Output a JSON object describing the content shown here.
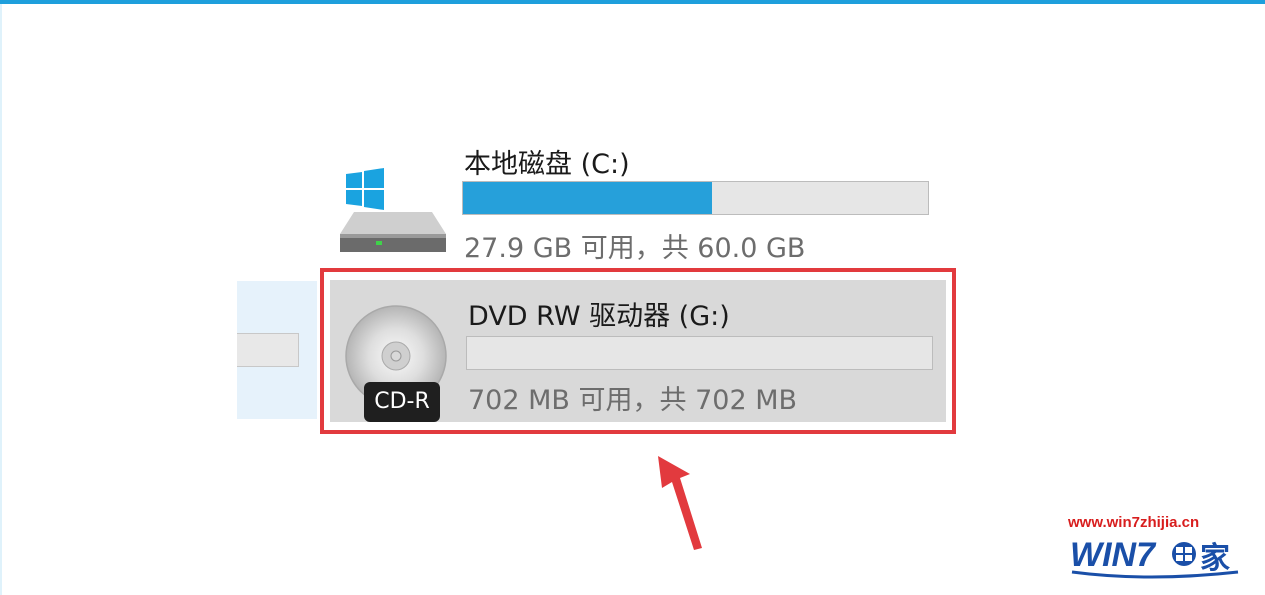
{
  "drives": [
    {
      "title": "本地磁盘 (C:)",
      "free_text": "27.9 GB 可用，共 60.0 GB",
      "used_fraction": 0.535,
      "icon": "hard-drive-windows-icon"
    },
    {
      "title": "DVD RW 驱动器 (G:)",
      "free_text": "702 MB 可用，共 702 MB",
      "used_fraction": 0,
      "icon": "cd-rom-icon",
      "badge": "CD-R",
      "selected": true
    }
  ],
  "watermark": {
    "url": "www.win7zhijia.cn",
    "logo_text": "WIN7",
    "logo_suffix": "家"
  },
  "colors": {
    "accent": "#26a0da",
    "highlight_box": "#e23a3e",
    "arrow": "#e23a3e",
    "selected_bg": "#d9d9d9",
    "watermark_red": "#d81e1e",
    "watermark_blue": "#1a4fa8"
  }
}
